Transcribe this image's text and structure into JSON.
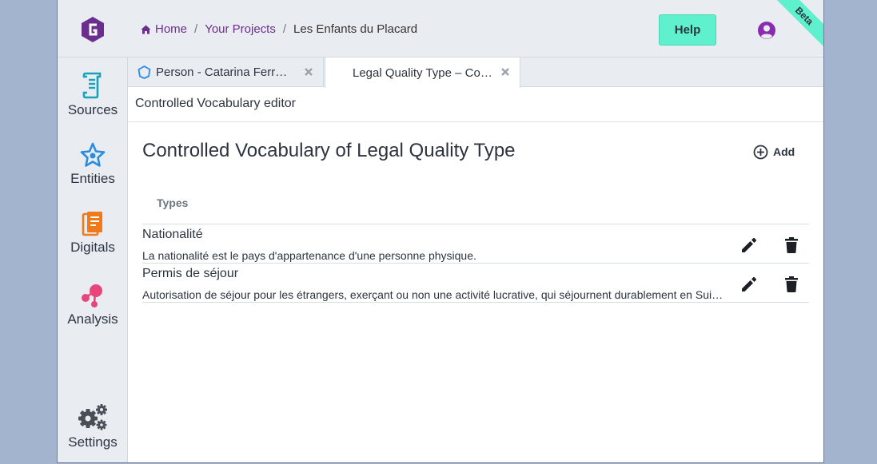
{
  "breadcrumb": {
    "home": "Home",
    "projects": "Your Projects",
    "current": "Les Enfants du Placard"
  },
  "header": {
    "help_label": "Help",
    "beta_label": "Beta",
    "user_icon": "user-circle-icon"
  },
  "sidebar": {
    "items": [
      {
        "label": "Sources",
        "icon": "scroll-icon",
        "color": "#1aa3b8"
      },
      {
        "label": "Entities",
        "icon": "star-icon",
        "color": "#2b8de0"
      },
      {
        "label": "Digitals",
        "icon": "document-icon",
        "color": "#f07a1a"
      },
      {
        "label": "Analysis",
        "icon": "network-icon",
        "color": "#e8457a"
      },
      {
        "label": "Settings",
        "icon": "gears-icon",
        "color": "#4a4f57"
      }
    ]
  },
  "tabs": [
    {
      "label": "Person - Catarina Ferreira",
      "icon": "person-tab-icon"
    },
    {
      "label": "Legal Quality Type – Controlled Vocabulary editor"
    }
  ],
  "panel": {
    "title": "Controlled Vocabulary editor",
    "heading": "Controlled Vocabulary of Legal Quality Type",
    "add_label": "Add",
    "column_header": "Types"
  },
  "types": [
    {
      "name": "Nationalité",
      "description": "La nationalité est le pays d'appartenance d'une personne physique."
    },
    {
      "name": "Permis de séjour",
      "description": "Autorisation de séjour pour les étrangers, exerçant ou non une activité lucrative, qui séjournent durablement en Suisse."
    }
  ],
  "colors": {
    "accent": "#6a2e8c",
    "help": "#5ff0cd",
    "background": "#a3b4cf"
  }
}
